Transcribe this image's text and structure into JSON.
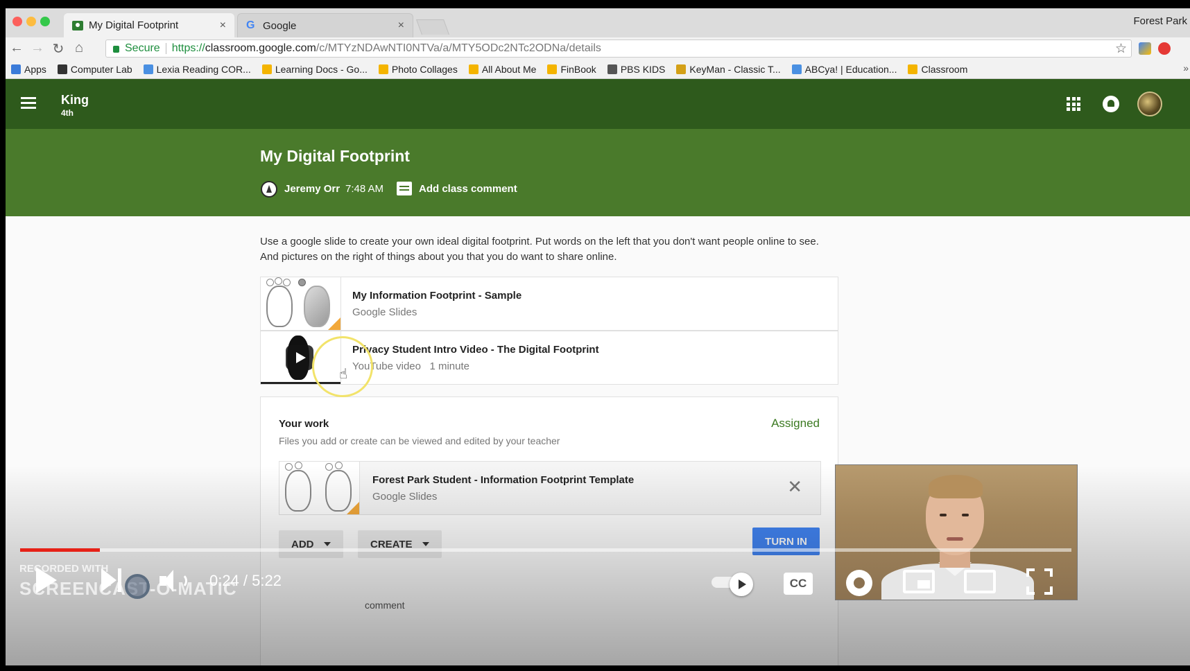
{
  "browser": {
    "tabs": [
      {
        "title": "My Digital Footprint",
        "close": "×",
        "active": true
      },
      {
        "title": "Google",
        "close": "×",
        "active": false
      }
    ],
    "profile_name": "Forest Park",
    "secure_label": "Secure",
    "url_scheme": "https://",
    "url_host": "classroom.google.com",
    "url_path": "/c/MTYzNDAwNTI0NTVa/a/MTY5ODc2NTc2ODNa/details",
    "star": "☆",
    "nav": {
      "back": "←",
      "forward": "→",
      "reload": "↻",
      "home": "⌂"
    },
    "bookmarks": [
      {
        "label": "Apps",
        "icon_color": "#3b7bd9"
      },
      {
        "label": "Computer Lab",
        "icon_color": "#333333"
      },
      {
        "label": "Lexia Reading COR...",
        "icon_color": "#4a90e2"
      },
      {
        "label": "Learning Docs - Go...",
        "icon_color": "#f4b400"
      },
      {
        "label": "Photo Collages",
        "icon_color": "#f4b400"
      },
      {
        "label": "All About Me",
        "icon_color": "#f4b400"
      },
      {
        "label": "FinBook",
        "icon_color": "#f4b400"
      },
      {
        "label": "PBS KIDS",
        "icon_color": "#555555"
      },
      {
        "label": "KeyMan - Classic T...",
        "icon_color": "#d4a017"
      },
      {
        "label": "ABCya! | Education...",
        "icon_color": "#4a90e2"
      },
      {
        "label": "Classroom",
        "icon_color": "#f4b400"
      }
    ],
    "bookmarks_more": "»"
  },
  "classroom": {
    "class_name": "King",
    "class_section": "4th",
    "header_color": "#2e5a1c",
    "banner_color": "#4a7a2b",
    "assignment": {
      "title": "My Digital Footprint",
      "author": "Jeremy Orr",
      "time": "7:48 AM",
      "add_comment": "Add class comment",
      "description": "Use a google slide to create your own ideal digital footprint. Put words on the left that you don't want people online to see. And pictures on the right of things about you that you do want to share online."
    },
    "attachments": [
      {
        "title": "My Information Footprint - Sample",
        "subtitle": "Google Slides"
      },
      {
        "title": "Privacy Student Intro Video - The Digital Footprint",
        "subtitle": "YouTube video   1 minute"
      }
    ],
    "your_work": {
      "title": "Your work",
      "status": "Assigned",
      "status_color": "#3c7a22",
      "help": "Files you add or create can be viewed and edited by your teacher",
      "file": {
        "title": "Forest Park Student - Information Footprint Template",
        "subtitle": "Google Slides",
        "remove": "✕"
      },
      "add_label": "ADD",
      "create_label": "CREATE",
      "turn_in_label": "TURN IN",
      "private_comment": "comment"
    }
  },
  "player": {
    "progress_fraction": 0.076,
    "progress_color": "#e62117",
    "time": "0:24 / 5:22",
    "cc_label": "CC",
    "watermark_line1": "RECORDED WITH",
    "watermark_line2": "SCREENCAST-O-MATIC"
  }
}
